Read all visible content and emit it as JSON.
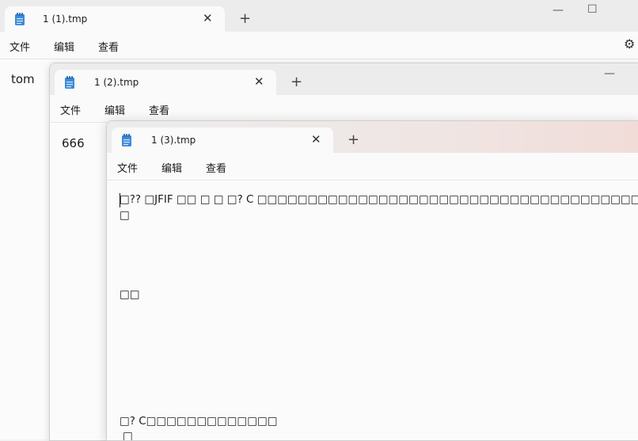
{
  "windows": [
    {
      "tab_title": "1 (1).tmp",
      "menu": [
        "文件",
        "编辑",
        "查看"
      ],
      "content": "tom"
    },
    {
      "tab_title": "1 (2).tmp",
      "menu": [
        "文件",
        "编辑",
        "查看"
      ],
      "content": "666"
    },
    {
      "tab_title": "1 (3).tmp",
      "menu": [
        "文件",
        "编辑",
        "查看"
      ],
      "lines": [
        "□?? □JFIF □□  □ □  □? C □□□□□□□□□□□□□□□□□□□□□□□□□□□□□□□□□□□□□□□□□□□      □□   □□□",
        "□",
        "□□",
        "□? C□□□□□□□□□□□□□",
        "□"
      ]
    }
  ],
  "icons": {
    "tab_icon": "notepad-icon",
    "close": "close-icon",
    "new_tab": "plus-icon",
    "minimize": "minimize-icon",
    "maximize": "maximize-icon",
    "settings": "gear-icon"
  },
  "glyphs": {
    "close": "✕",
    "plus": "+",
    "minimize": "—",
    "maximize": "☐",
    "gear": "⚙"
  },
  "colors": {
    "titlebar": "#ececec",
    "editor": "#fafafa",
    "accent_icon": "#1f6fb8"
  }
}
